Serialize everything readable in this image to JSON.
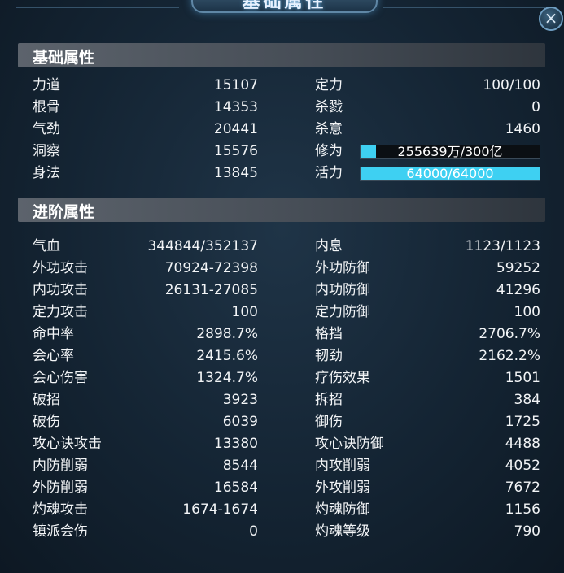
{
  "window": {
    "title": "基础属性",
    "close_icon": "×"
  },
  "basic": {
    "header": "基础属性",
    "left": [
      {
        "label": "力道",
        "value": "15107"
      },
      {
        "label": "根骨",
        "value": "14353"
      },
      {
        "label": "气劲",
        "value": "20441"
      },
      {
        "label": "洞察",
        "value": "15576"
      },
      {
        "label": "身法",
        "value": "13845"
      }
    ],
    "right": [
      {
        "label": "定力",
        "value": "100/100"
      },
      {
        "label": "杀戮",
        "value": "0"
      },
      {
        "label": "杀意",
        "value": "1460"
      }
    ],
    "xiuwei": {
      "label": "修为",
      "text": "255639万/300亿",
      "fill_fraction": 0.085
    },
    "huoli": {
      "label": "活力",
      "text": "64000/64000",
      "fill_fraction": 1.0
    }
  },
  "advanced": {
    "header": "进阶属性",
    "left": [
      {
        "label": "气血",
        "value": "344844/352137"
      },
      {
        "label": "外功攻击",
        "value": "70924-72398"
      },
      {
        "label": "内功攻击",
        "value": "26131-27085"
      },
      {
        "label": "定力攻击",
        "value": "100"
      },
      {
        "label": "命中率",
        "value": "2898.7%"
      },
      {
        "label": "会心率",
        "value": "2415.6%"
      },
      {
        "label": "会心伤害",
        "value": "1324.7%"
      },
      {
        "label": "破招",
        "value": "3923"
      },
      {
        "label": "破伤",
        "value": "6039"
      },
      {
        "label": "攻心诀攻击",
        "value": "13380"
      },
      {
        "label": "内防削弱",
        "value": "8544"
      },
      {
        "label": "外防削弱",
        "value": "16584"
      },
      {
        "label": "灼魂攻击",
        "value": "1674-1674"
      },
      {
        "label": "镇派会伤",
        "value": "0"
      }
    ],
    "right": [
      {
        "label": "内息",
        "value": "1123/1123"
      },
      {
        "label": "外功防御",
        "value": "59252"
      },
      {
        "label": "内功防御",
        "value": "41296"
      },
      {
        "label": "定力防御",
        "value": "100"
      },
      {
        "label": "格挡",
        "value": "2706.7%"
      },
      {
        "label": "韧劲",
        "value": "2162.2%"
      },
      {
        "label": "疗伤效果",
        "value": "1501"
      },
      {
        "label": "拆招",
        "value": "384"
      },
      {
        "label": "御伤",
        "value": "1725"
      },
      {
        "label": "攻心诀防御",
        "value": "4488"
      },
      {
        "label": "内攻削弱",
        "value": "4052"
      },
      {
        "label": "外攻削弱",
        "value": "7672"
      },
      {
        "label": "灼魂防御",
        "value": "1156"
      },
      {
        "label": "灼魂等级",
        "value": "790"
      }
    ]
  },
  "colors": {
    "bar_fill": "#3ed0f2",
    "panel_bg": "#142433",
    "header_bg": "#5c636c"
  }
}
